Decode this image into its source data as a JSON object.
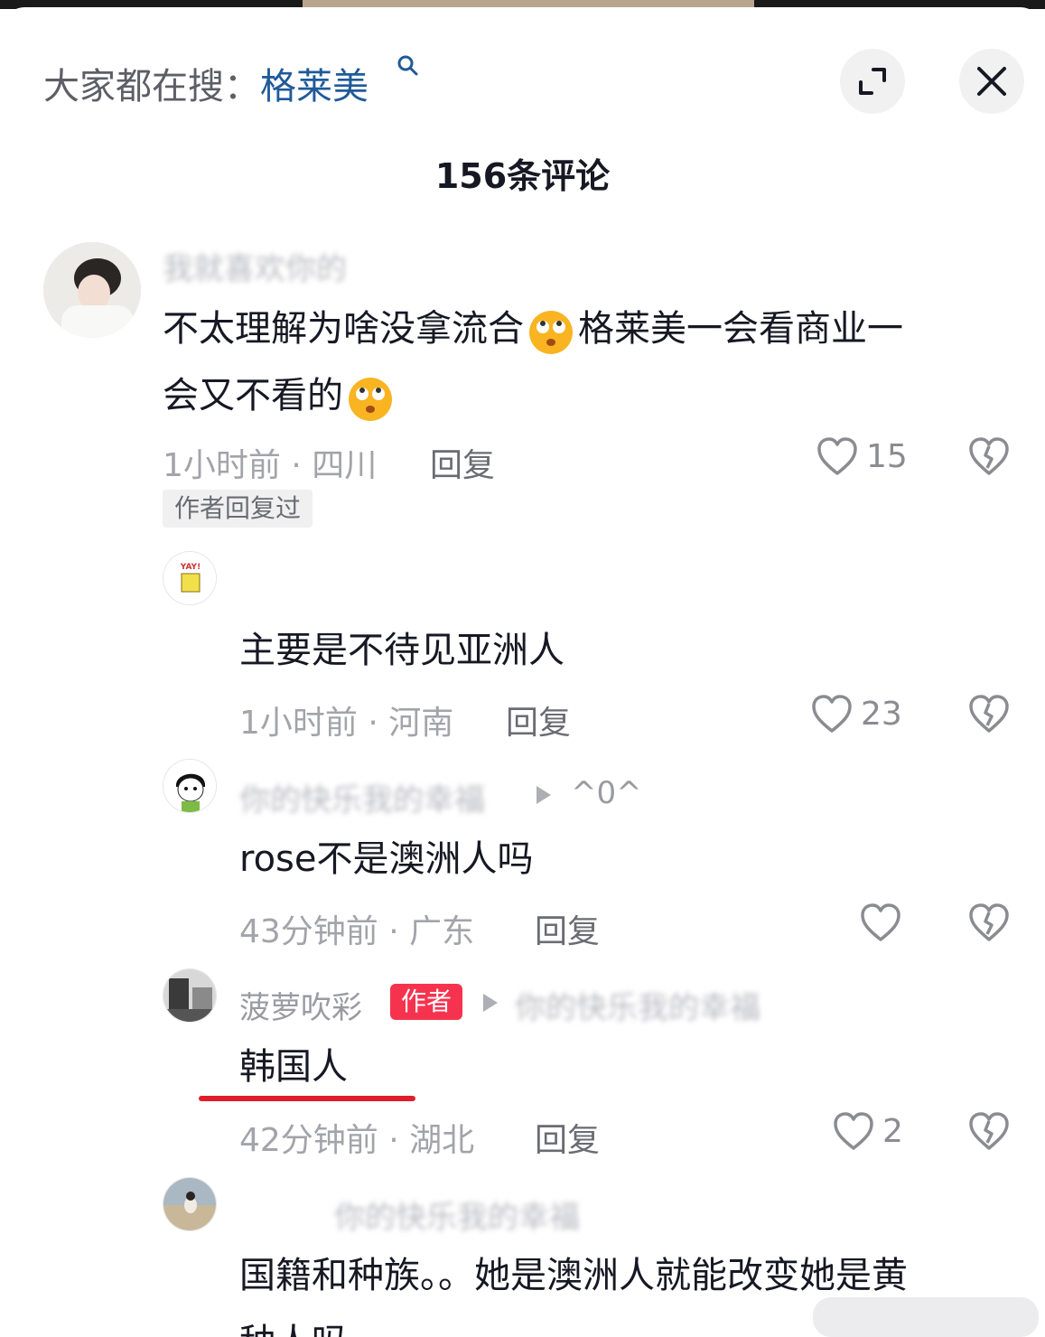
{
  "header": {
    "search_prefix": "大家都在搜：",
    "search_keyword": "格莱美",
    "comment_count": "156条评论"
  },
  "comments": [
    {
      "username": "我就喜欢你的",
      "content_a": "不太理解为啥没拿流合",
      "content_b": "格莱美一会看商业一",
      "content_c": "会又不看的",
      "meta": "1小时前 · 四川",
      "reply": "回复",
      "likes": "15",
      "tag": "作者回复过"
    },
    {
      "content": "主要是不待见亚洲人",
      "meta": "1小时前 · 河南",
      "reply": "回复",
      "likes": "23"
    },
    {
      "username": "你的快乐我的幸福",
      "reply_to": "^0^",
      "content": "rose不是澳洲人吗",
      "meta": "43分钟前 · 广东",
      "reply": "回复"
    },
    {
      "username": "菠萝吹彩",
      "badge": "作者",
      "reply_to": "你的快乐我的幸福",
      "content": "韩国人",
      "meta": "42分钟前 · 湖北",
      "reply": "回复",
      "likes": "2"
    },
    {
      "username": "你的快乐我的幸福",
      "content_a": "国籍和种族。。她是澳洲人就能改变她是黄",
      "content_b": "种人吗"
    }
  ],
  "colors": {
    "accent_red": "#e01d2a",
    "author_badge": "#f6334f",
    "keyword_blue": "#1f5a99"
  }
}
